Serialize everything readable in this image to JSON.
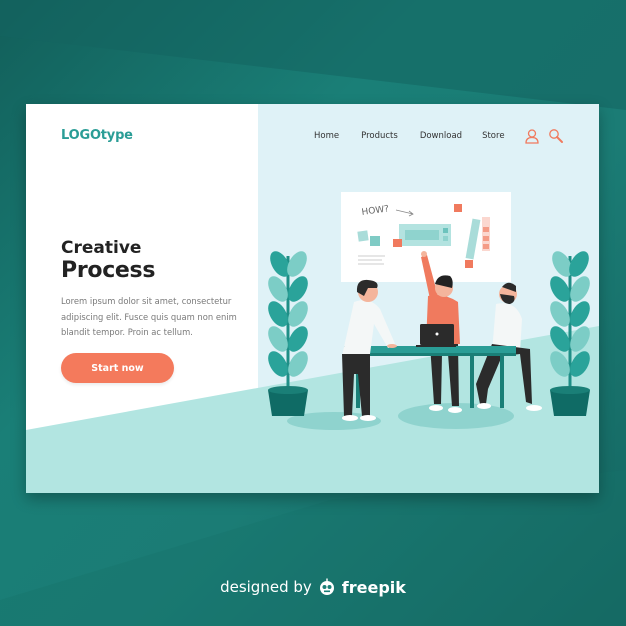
{
  "header": {
    "logo": "LOGOtype",
    "nav": [
      "Home",
      "Products",
      "Download",
      "Store"
    ],
    "icons": [
      "user-icon",
      "search-icon"
    ]
  },
  "hero": {
    "title_line1": "Creative",
    "title_line2": "Process",
    "body": "Lorem ipsum dolor sit amet, consectetur adipiscing elit. Fusce quis quam non enim blandit tempor. Proin ac tellum.",
    "cta_label": "Start now"
  },
  "illustration": {
    "whiteboard_text": "HOW?"
  },
  "footer": {
    "prefix": "designed by",
    "brand": "freepik"
  },
  "colors": {
    "accent": "#f47a5c",
    "brand_teal": "#2a9d96",
    "panel_bg": "#dff2f7",
    "floor": "#b2e5e1",
    "background": "#1a7f77"
  }
}
